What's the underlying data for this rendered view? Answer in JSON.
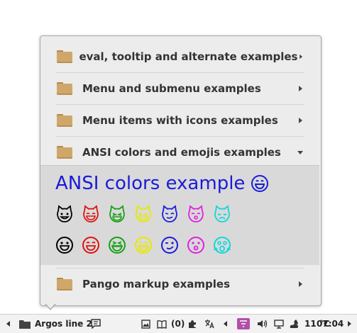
{
  "menu": {
    "items": [
      {
        "label": "eval, tooltip and alternate examples",
        "arrow": "right"
      },
      {
        "label": "Menu and submenu examples",
        "arrow": "right"
      },
      {
        "label": "Menu items with icons examples",
        "arrow": "right"
      },
      {
        "label": "ANSI colors and emojis examples",
        "arrow": "down"
      }
    ],
    "expanded": {
      "title": "ANSI colors example",
      "title_color": "#1b1bd8",
      "cat_row_colors": [
        "#000000",
        "#e01010",
        "#16a016",
        "#e8e800",
        "#1b1bd8",
        "#e020e0",
        "#10d8d8"
      ],
      "smiley_row_colors": [
        "#000000",
        "#e01010",
        "#16a016",
        "#e8e800",
        "#1b1bd8",
        "#e020e0",
        "#10d8d8"
      ]
    },
    "last_item": {
      "label": "Pango markup examples",
      "arrow": "right"
    }
  },
  "taskbar": {
    "app_label": "Argos line 2",
    "updates": "(0)",
    "temperature": "11 °C",
    "time": "07:04"
  },
  "colors": {
    "folder": "#cfa76a",
    "popup_bg": "#ececec",
    "expanded_bg": "#d9d9d9"
  }
}
